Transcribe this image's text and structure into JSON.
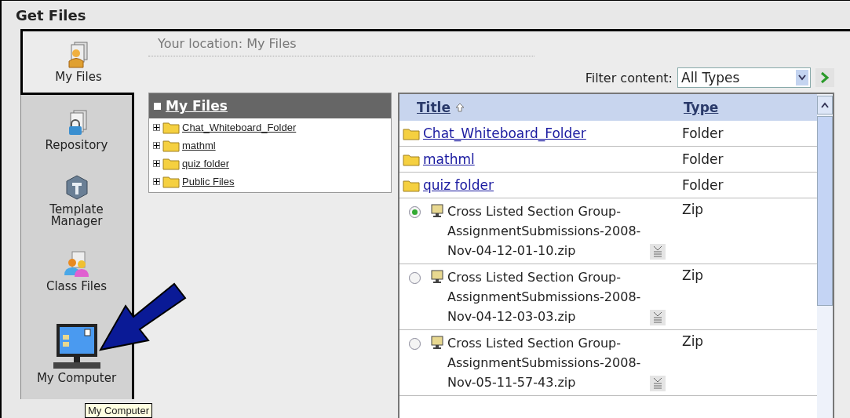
{
  "window": {
    "title": "Get Files"
  },
  "sidebar": {
    "items": [
      {
        "label": "My Files",
        "selected": true
      },
      {
        "label": "Repository",
        "selected": false
      },
      {
        "label": "Template Manager",
        "selected": false
      },
      {
        "label": "Class Files",
        "selected": false
      },
      {
        "label": "My Computer",
        "selected": false
      }
    ]
  },
  "location": "Your location: My Files",
  "filter": {
    "label": "Filter content:",
    "value": "All Types"
  },
  "tree": {
    "root": "My Files",
    "children": [
      {
        "label": "Chat_Whiteboard_Folder",
        "expanded": false
      },
      {
        "label": "mathml",
        "expanded": false
      },
      {
        "label": "quiz folder",
        "expanded": false
      },
      {
        "label": "Public Files",
        "expanded": false
      }
    ]
  },
  "table": {
    "columns": [
      {
        "label": "Title",
        "sorted": true
      },
      {
        "label": "Type",
        "sorted": false
      }
    ],
    "rows": [
      {
        "kind": "folder",
        "title": "Chat_Whiteboard_Folder",
        "type": "Folder"
      },
      {
        "kind": "folder",
        "title": "mathml",
        "type": "Folder"
      },
      {
        "kind": "folder",
        "title": "quiz folder",
        "type": "Folder"
      },
      {
        "kind": "file",
        "title": "Cross Listed Section Group-AssignmentSubmissions-2008-Nov-04-12-01-10.zip",
        "type": "Zip",
        "selected": true
      },
      {
        "kind": "file",
        "title": "Cross Listed Section Group-AssignmentSubmissions-2008-Nov-04-12-03-03.zip",
        "type": "Zip",
        "selected": false
      },
      {
        "kind": "file",
        "title": "Cross Listed Section Group-AssignmentSubmissions-2008-Nov-05-11-57-43.zip",
        "type": "Zip",
        "selected": false
      }
    ]
  },
  "tooltip": "My Computer"
}
